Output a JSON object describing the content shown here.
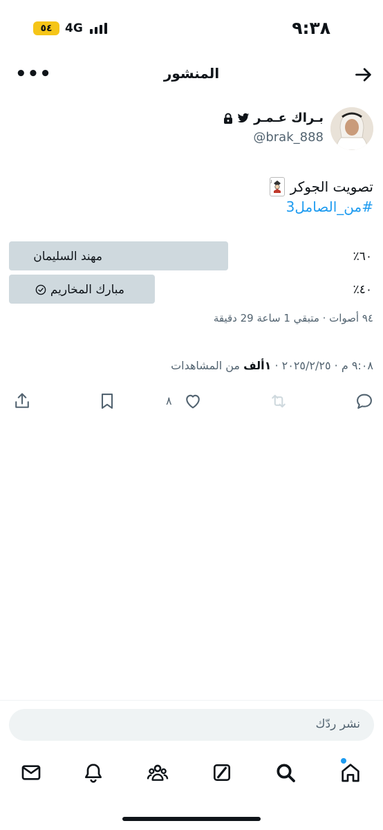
{
  "status_bar": {
    "time": "٩:٣٨",
    "network": "4G",
    "battery": "٥٤"
  },
  "header": {
    "title": "المنشور",
    "back_icon": "arrow-right-icon",
    "more_label": "•••"
  },
  "author": {
    "name": "بـراك عـمـر",
    "handle": "@brak_888"
  },
  "tweet": {
    "text": "تصويت الجوكر",
    "emoji_icon": "joker-card-icon",
    "hashtag": "#من_الصامل3"
  },
  "poll": {
    "options": [
      {
        "label": "مهند السليمان",
        "percent_label": "٪٦٠",
        "percent": 60,
        "selected": false
      },
      {
        "label": "مبارك المخاريم",
        "percent_label": "٪٤٠",
        "percent": 40,
        "selected": true
      }
    ],
    "summary": "٩٤ أصوات · متبقي 1 ساعة 29 دقيقة"
  },
  "timestamp": {
    "date_time": "٩:٠٨ م · ٢٠٢٥/٢/٢٥ · ",
    "views_count": "١ألف",
    "views_label": " من المشاهدات"
  },
  "actions": {
    "likes": "٨"
  },
  "reply": {
    "placeholder": "نشر ردّك"
  },
  "colors": {
    "accent": "#1d9bf0",
    "poll_bar": "#cfd9de",
    "battery": "#f5c518"
  }
}
